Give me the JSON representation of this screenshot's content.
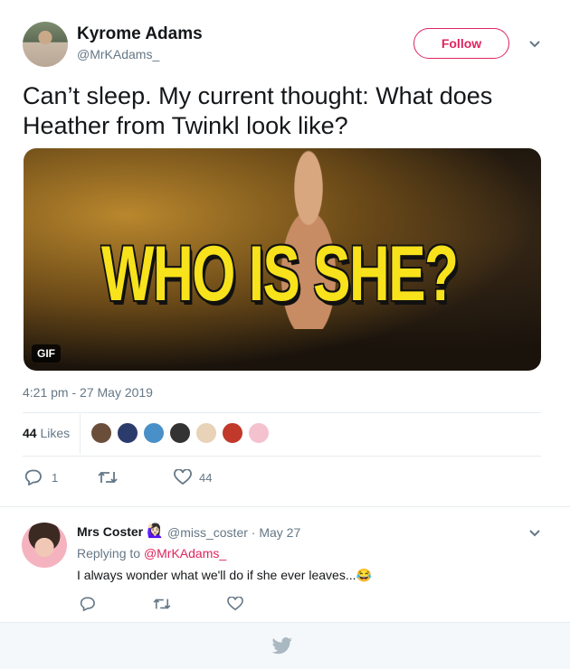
{
  "tweet": {
    "author_name": "Kyrome Adams",
    "author_handle": "@MrKAdams_",
    "follow_label": "Follow",
    "text": "Can’t sleep. My current thought: What does Heather from Twinkl look like?",
    "gif_caption": "WHO IS SHE?",
    "gif_badge": "GIF",
    "timestamp": "4:21 pm - 27 May 2019",
    "likes_count": "44",
    "likes_label": "Likes",
    "reply_count": "1",
    "retweet_count": "",
    "like_count": "44",
    "accent_color": "#e0245e"
  },
  "reply": {
    "author_name": "Mrs Coster",
    "author_emoji": "🙋🏻‍♀️",
    "author_handle": "@miss_coster",
    "date": "· May 27",
    "replying_prefix": "Replying to ",
    "replying_to": "@MrKAdams_",
    "text": "I always wonder what we'll do if she ever leaves...😂"
  },
  "icons": {
    "reply": "reply-icon",
    "retweet": "retweet-icon",
    "like": "heart-icon",
    "caret": "chevron-down-icon",
    "twitter": "twitter-bird-icon"
  }
}
